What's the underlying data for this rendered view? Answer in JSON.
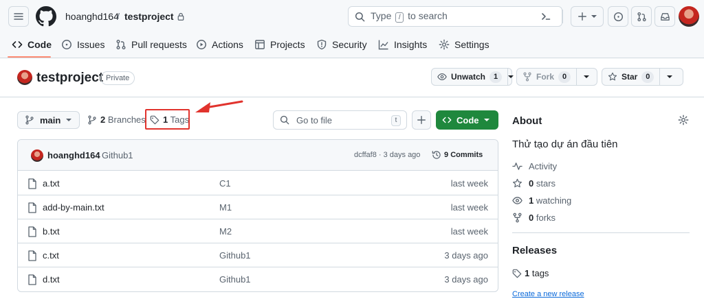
{
  "header": {
    "owner": "hoanghd164",
    "separator": "/",
    "repo": "testproject",
    "search_prefix": "Type",
    "search_key": "/",
    "search_suffix": "to search"
  },
  "nav": {
    "code": "Code",
    "issues": "Issues",
    "pulls": "Pull requests",
    "actions": "Actions",
    "projects": "Projects",
    "security": "Security",
    "insights": "Insights",
    "settings": "Settings"
  },
  "repo": {
    "title": "testproject",
    "visibility": "Private",
    "unwatch_label": "Unwatch",
    "watch_count": "1",
    "fork_label": "Fork",
    "fork_count": "0",
    "star_label": "Star",
    "star_count": "0"
  },
  "toolbar": {
    "branch": "main",
    "branches_count": "2",
    "branches_label": "Branches",
    "tags_count": "1",
    "tags_label": "Tags",
    "goto_placeholder": "Go to file",
    "goto_key": "t",
    "code_label": "Code"
  },
  "commit": {
    "author": "hoanghd164",
    "message": "Github1",
    "meta": "dcffaf8 · 3 days ago",
    "commits_count": "9",
    "commits_label": "Commits"
  },
  "files": [
    {
      "name": "a.txt",
      "message": "C1",
      "time": "last week"
    },
    {
      "name": "add-by-main.txt",
      "message": "M1",
      "time": "last week"
    },
    {
      "name": "b.txt",
      "message": "M2",
      "time": "last week"
    },
    {
      "name": "c.txt",
      "message": "Github1",
      "time": "3 days ago"
    },
    {
      "name": "d.txt",
      "message": "Github1",
      "time": "3 days ago"
    }
  ],
  "about": {
    "title": "About",
    "description": "Thử tạo dự án đầu tiên",
    "activity": "Activity",
    "stars_count": "0",
    "stars_label": "stars",
    "watching_count": "1",
    "watching_label": "watching",
    "forks_count": "0",
    "forks_label": "forks"
  },
  "releases": {
    "title": "Releases",
    "tags_count": "1",
    "tags_label": "tags",
    "create_link": "Create a new release"
  },
  "colors": {
    "accent_underline": "#fd8c73",
    "code_button": "#1f883d",
    "annotation_red": "#e1332d",
    "link_blue": "#0969da"
  }
}
